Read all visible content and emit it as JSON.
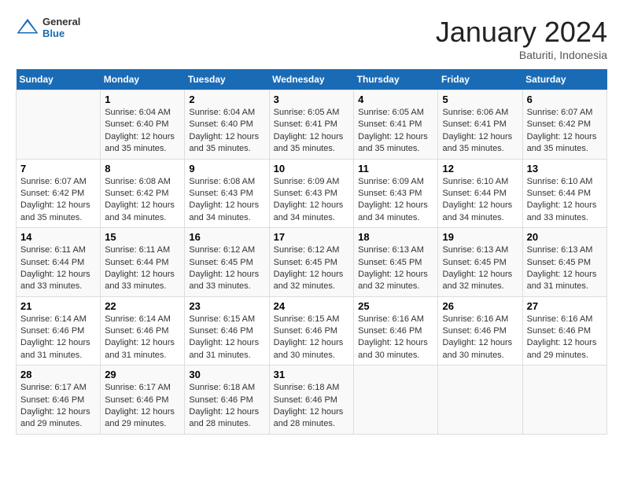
{
  "header": {
    "logo": {
      "general": "General",
      "blue": "Blue"
    },
    "title": "January 2024",
    "subtitle": "Baturiti, Indonesia"
  },
  "calendar": {
    "days_of_week": [
      "Sunday",
      "Monday",
      "Tuesday",
      "Wednesday",
      "Thursday",
      "Friday",
      "Saturday"
    ],
    "weeks": [
      [
        {
          "day": "",
          "info": ""
        },
        {
          "day": "1",
          "info": "Sunrise: 6:04 AM\nSunset: 6:40 PM\nDaylight: 12 hours\nand 35 minutes."
        },
        {
          "day": "2",
          "info": "Sunrise: 6:04 AM\nSunset: 6:40 PM\nDaylight: 12 hours\nand 35 minutes."
        },
        {
          "day": "3",
          "info": "Sunrise: 6:05 AM\nSunset: 6:41 PM\nDaylight: 12 hours\nand 35 minutes."
        },
        {
          "day": "4",
          "info": "Sunrise: 6:05 AM\nSunset: 6:41 PM\nDaylight: 12 hours\nand 35 minutes."
        },
        {
          "day": "5",
          "info": "Sunrise: 6:06 AM\nSunset: 6:41 PM\nDaylight: 12 hours\nand 35 minutes."
        },
        {
          "day": "6",
          "info": "Sunrise: 6:07 AM\nSunset: 6:42 PM\nDaylight: 12 hours\nand 35 minutes."
        }
      ],
      [
        {
          "day": "7",
          "info": ""
        },
        {
          "day": "8",
          "info": "Sunrise: 6:08 AM\nSunset: 6:42 PM\nDaylight: 12 hours\nand 34 minutes."
        },
        {
          "day": "9",
          "info": "Sunrise: 6:08 AM\nSunset: 6:43 PM\nDaylight: 12 hours\nand 34 minutes."
        },
        {
          "day": "10",
          "info": "Sunrise: 6:09 AM\nSunset: 6:43 PM\nDaylight: 12 hours\nand 34 minutes."
        },
        {
          "day": "11",
          "info": "Sunrise: 6:09 AM\nSunset: 6:43 PM\nDaylight: 12 hours\nand 34 minutes."
        },
        {
          "day": "12",
          "info": "Sunrise: 6:10 AM\nSunset: 6:44 PM\nDaylight: 12 hours\nand 34 minutes."
        },
        {
          "day": "13",
          "info": "Sunrise: 6:10 AM\nSunset: 6:44 PM\nDaylight: 12 hours\nand 33 minutes."
        }
      ],
      [
        {
          "day": "14",
          "info": ""
        },
        {
          "day": "15",
          "info": "Sunrise: 6:11 AM\nSunset: 6:44 PM\nDaylight: 12 hours\nand 33 minutes."
        },
        {
          "day": "16",
          "info": "Sunrise: 6:12 AM\nSunset: 6:45 PM\nDaylight: 12 hours\nand 33 minutes."
        },
        {
          "day": "17",
          "info": "Sunrise: 6:12 AM\nSunset: 6:45 PM\nDaylight: 12 hours\nand 32 minutes."
        },
        {
          "day": "18",
          "info": "Sunrise: 6:13 AM\nSunset: 6:45 PM\nDaylight: 12 hours\nand 32 minutes."
        },
        {
          "day": "19",
          "info": "Sunrise: 6:13 AM\nSunset: 6:45 PM\nDaylight: 12 hours\nand 32 minutes."
        },
        {
          "day": "20",
          "info": "Sunrise: 6:13 AM\nSunset: 6:45 PM\nDaylight: 12 hours\nand 31 minutes."
        }
      ],
      [
        {
          "day": "21",
          "info": ""
        },
        {
          "day": "22",
          "info": "Sunrise: 6:14 AM\nSunset: 6:46 PM\nDaylight: 12 hours\nand 31 minutes."
        },
        {
          "day": "23",
          "info": "Sunrise: 6:15 AM\nSunset: 6:46 PM\nDaylight: 12 hours\nand 31 minutes."
        },
        {
          "day": "24",
          "info": "Sunrise: 6:15 AM\nSunset: 6:46 PM\nDaylight: 12 hours\nand 30 minutes."
        },
        {
          "day": "25",
          "info": "Sunrise: 6:16 AM\nSunset: 6:46 PM\nDaylight: 12 hours\nand 30 minutes."
        },
        {
          "day": "26",
          "info": "Sunrise: 6:16 AM\nSunset: 6:46 PM\nDaylight: 12 hours\nand 30 minutes."
        },
        {
          "day": "27",
          "info": "Sunrise: 6:16 AM\nSunset: 6:46 PM\nDaylight: 12 hours\nand 29 minutes."
        }
      ],
      [
        {
          "day": "28",
          "info": ""
        },
        {
          "day": "29",
          "info": "Sunrise: 6:17 AM\nSunset: 6:46 PM\nDaylight: 12 hours\nand 29 minutes."
        },
        {
          "day": "30",
          "info": "Sunrise: 6:18 AM\nSunset: 6:46 PM\nDaylight: 12 hours\nand 28 minutes."
        },
        {
          "day": "31",
          "info": "Sunrise: 6:18 AM\nSunset: 6:46 PM\nDaylight: 12 hours\nand 28 minutes."
        },
        {
          "day": "",
          "info": ""
        },
        {
          "day": "",
          "info": ""
        },
        {
          "day": "",
          "info": ""
        }
      ]
    ],
    "week7_sunday": {
      "day": "7",
      "info": "Sunrise: 6:07 AM\nSunset: 6:42 PM\nDaylight: 12 hours\nand 35 minutes."
    },
    "week14_sunday": {
      "day": "14",
      "info": "Sunrise: 6:11 AM\nSunset: 6:44 PM\nDaylight: 12 hours\nand 33 minutes."
    },
    "week21_sunday": {
      "day": "21",
      "info": "Sunrise: 6:14 AM\nSunset: 6:46 PM\nDaylight: 12 hours\nand 31 minutes."
    },
    "week28_sunday": {
      "day": "28",
      "info": "Sunrise: 6:17 AM\nSunset: 6:46 PM\nDaylight: 12 hours\nand 29 minutes."
    }
  }
}
